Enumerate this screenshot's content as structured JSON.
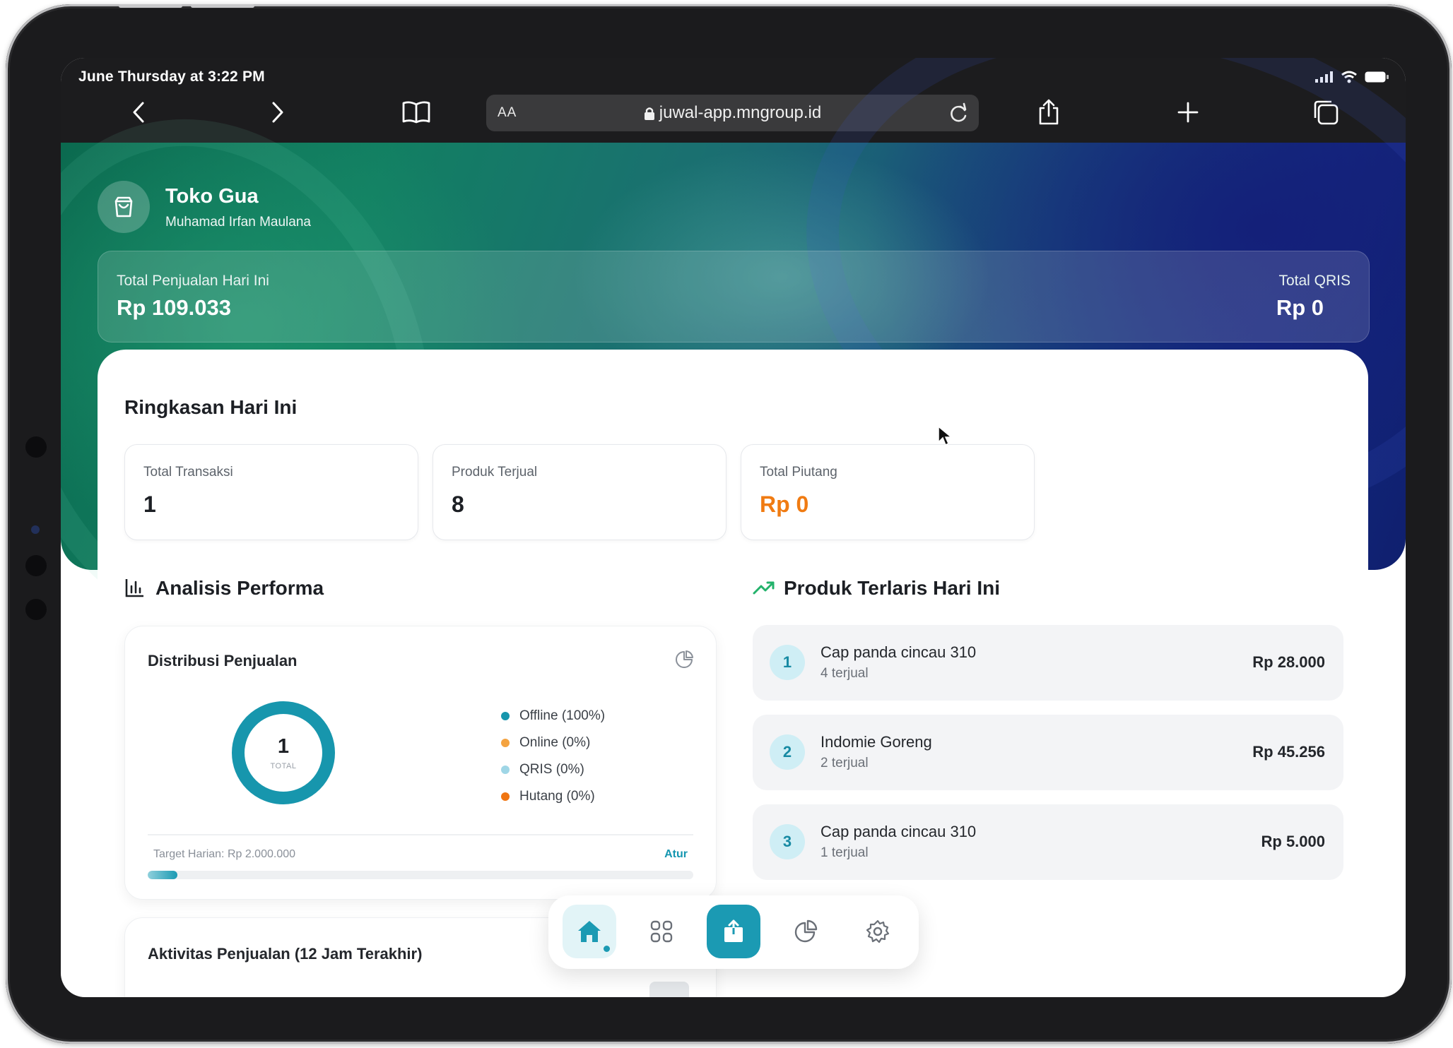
{
  "status_bar": {
    "time": "June Thursday at 3:22 PM"
  },
  "browser": {
    "aa_label": "AA",
    "url": "juwal-app.mngroup.id"
  },
  "store": {
    "name": "Toko Gua",
    "owner": "Muhamad Irfan Maulana"
  },
  "summary_bar": {
    "sales_label": "Total Penjualan Hari Ini",
    "sales_value": "Rp 109.033",
    "qris_label": "Total QRIS",
    "qris_value": "Rp 0"
  },
  "ringkasan": {
    "title": "Ringkasan Hari Ini",
    "cards": [
      {
        "label": "Total Transaksi",
        "value": "1"
      },
      {
        "label": "Produk Terjual",
        "value": "8"
      },
      {
        "label": "Total Piutang",
        "value": "Rp 0"
      }
    ]
  },
  "analisis": {
    "title": "Analisis Performa",
    "distribution": {
      "title": "Distribusi Penjualan",
      "total_value": "1",
      "total_caption": "TOTAL",
      "legend": [
        {
          "label": "Offline (100%)",
          "color": "#1796ad"
        },
        {
          "label": "Online (0%)",
          "color": "#f4a340"
        },
        {
          "label": "QRIS (0%)",
          "color": "#9fd6e6"
        },
        {
          "label": "Hutang (0%)",
          "color": "#f07512"
        }
      ],
      "target_label": "Target Harian: Rp 2.000.000",
      "target_link": "Atur",
      "progress_fraction": 0.055
    },
    "activity": {
      "title": "Aktivitas Penjualan (12 Jam Terakhir)"
    }
  },
  "produk_terlaris": {
    "title": "Produk Terlaris Hari Ini",
    "items": [
      {
        "rank": "1",
        "name": "Cap panda cincau 310",
        "sold": "4 terjual",
        "price": "Rp 28.000"
      },
      {
        "rank": "2",
        "name": "Indomie Goreng",
        "sold": "2 terjual",
        "price": "Rp 45.256"
      },
      {
        "rank": "3",
        "name": "Cap panda cincau 310",
        "sold": "1 terjual",
        "price": "Rp 5.000"
      }
    ]
  },
  "colors": {
    "accent": "#1b9ab3",
    "warning": "#f07b12",
    "trend_green": "#23b26b"
  }
}
